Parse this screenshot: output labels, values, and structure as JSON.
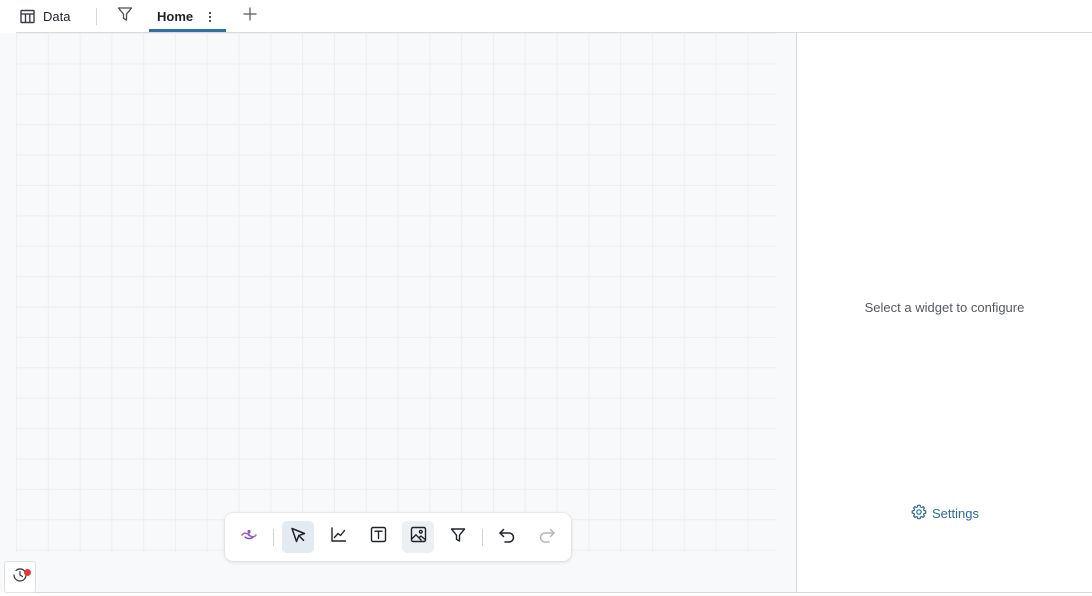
{
  "tabbar": {
    "data_tab_label": "Data",
    "data_tab_icon": "table-icon",
    "filter_icon": "filter-icon",
    "pages": [
      {
        "label": "Home",
        "active": true,
        "menu_icon": "kebab-icon"
      }
    ],
    "add_page_icon": "plus-icon",
    "active_underline_color": "#2f6fa6"
  },
  "right_panel": {
    "message": "Select a widget to configure",
    "settings_label": "Settings",
    "settings_icon": "gear-icon",
    "link_color": "#2b6a9b"
  },
  "toolbar": {
    "items": [
      {
        "icon": "assistant-logo-icon",
        "active": false
      },
      {
        "icon": "select-cursor-icon",
        "active": true
      },
      {
        "icon": "line-chart-icon",
        "active": false
      },
      {
        "icon": "text-box-icon",
        "active": false
      },
      {
        "icon": "image-icon",
        "active": false,
        "hover": true
      },
      {
        "icon": "filter-icon",
        "active": false
      },
      {
        "icon": "undo-icon",
        "enabled": true
      },
      {
        "icon": "redo-icon",
        "enabled": false
      }
    ]
  },
  "corner": {
    "history_icon": "history-icon",
    "has_notification": true,
    "notification_color": "#e53935"
  }
}
